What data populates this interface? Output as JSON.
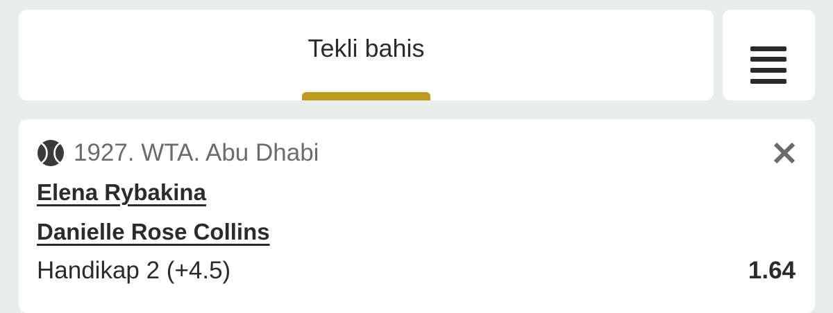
{
  "tabs": {
    "active_label": "Tekli bahis",
    "accent_color": "#c09a1c"
  },
  "menu": {
    "icon": "hamburger-menu-icon"
  },
  "bet": {
    "sport_icon": "tennis-ball-icon",
    "league": "1927. WTA. Abu Dhabi",
    "team_1": "Elena Rybakina",
    "team_2": "Danielle Rose Collins",
    "market": "Handikap 2 (+4.5)",
    "odds": "1.64",
    "remove_icon": "close-icon"
  }
}
